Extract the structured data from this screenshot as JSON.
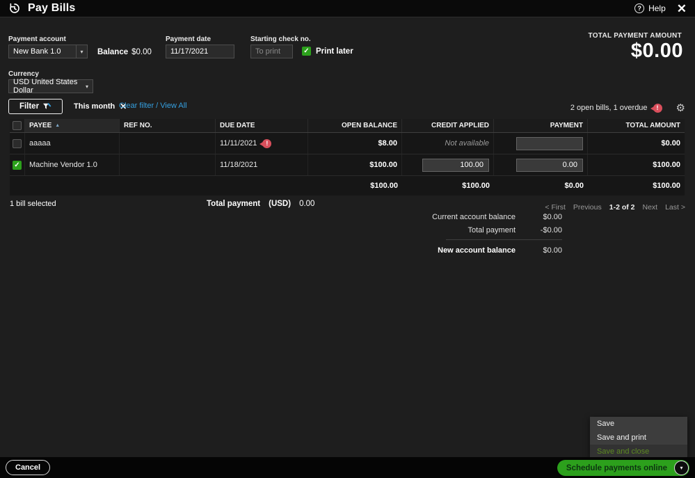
{
  "header": {
    "title": "Pay Bills",
    "help_label": "Help"
  },
  "payment_bar": {
    "account_label": "Payment account",
    "account_value": "New Bank 1.0",
    "balance_label": "Balance",
    "balance_value": "$0.00",
    "date_label": "Payment date",
    "date_value": "11/17/2021",
    "check_label": "Starting check no.",
    "check_placeholder": "To print",
    "print_later_label": "Print later",
    "total_label": "TOTAL PAYMENT AMOUNT",
    "total_value": "$0.00"
  },
  "currency": {
    "label": "Currency",
    "value": "USD United States Dollar"
  },
  "filter_bar": {
    "filter_label": "Filter",
    "chip_label": "This month",
    "clear_link": "Clear filter / View All",
    "bills_summary": "2 open bills, 1 overdue"
  },
  "table": {
    "columns": {
      "payee": "PAYEE",
      "ref": "REF NO.",
      "due": "DUE DATE",
      "open_balance": "OPEN BALANCE",
      "credit": "CREDIT APPLIED",
      "payment": "PAYMENT",
      "total": "TOTAL AMOUNT"
    },
    "rows": [
      {
        "payee": "aaaaa",
        "ref": "",
        "due_date": "11/11/2021",
        "overdue": "!",
        "open_balance": "$8.00",
        "credit_applied": "Not available",
        "payment_value": "",
        "total": "$0.00"
      },
      {
        "payee": "Machine Vendor 1.0",
        "ref": "",
        "due_date": "11/18/2021",
        "open_balance": "$100.00",
        "credit_value": "100.00",
        "payment_value": "0.00",
        "total": "$100.00"
      }
    ],
    "totals": {
      "open_balance": "$100.00",
      "credit_applied": "$100.00",
      "payment": "$0.00",
      "total": "$100.00"
    }
  },
  "selection": {
    "bills_selected": "1 bill selected",
    "total_payment_label": "Total payment",
    "currency_code": "(USD)",
    "amount": "0.00"
  },
  "pagination": {
    "first": "< First",
    "previous": "Previous",
    "range": "1-2 of 2",
    "next": "Next",
    "last": "Last >"
  },
  "summary": {
    "current_label": "Current account balance",
    "current_value": "$0.00",
    "payment_label": "Total payment",
    "payment_value": "-$0.00",
    "new_label": "New account balance",
    "new_value": "$0.00"
  },
  "save_menu": {
    "save": "Save",
    "save_print": "Save and print",
    "save_close": "Save and close"
  },
  "footer": {
    "cancel": "Cancel",
    "schedule": "Schedule payments online"
  },
  "status_badge": "!",
  "icons": {
    "help": "?",
    "close": "✕",
    "chip_close": "✕",
    "gear": "⚙",
    "caret_down": "▾",
    "check": "✓",
    "sort_asc": "▲"
  },
  "colors": {
    "accent_green": "#2ca01c",
    "alert_red": "#d94f5c",
    "link_blue": "#35a0e0"
  }
}
